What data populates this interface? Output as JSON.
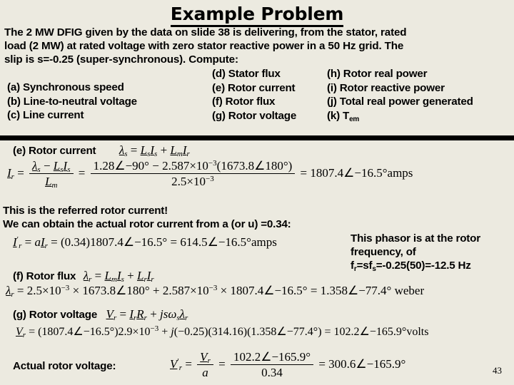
{
  "slide": {
    "title": "Example Problem",
    "page_number": "43",
    "background_color": "#ECEAE0",
    "divider_color": "#000000"
  },
  "problem": {
    "statement_lines": [
      "The 2 MW DFIG given by the data on slide 38 is delivering, from the stator, rated",
      "load (2 MW) at rated voltage with zero stator reactive power in a 50 Hz grid. The",
      "slip is s=-0.25 (super-synchronous). Compute:"
    ]
  },
  "compute_list": {
    "column_a": [
      "(a) Synchronous speed",
      "(b) Line-to-neutral voltage",
      "(c) Line current"
    ],
    "column_d": [
      "(d) Stator flux",
      "(e) Rotor current",
      "(f) Rotor flux",
      "(g) Rotor voltage"
    ],
    "column_h": [
      "(h) Rotor real power",
      "(i) Rotor reactive power",
      "(j) Total real power generated",
      "(k) Tem"
    ],
    "k_label_base": "(k) T",
    "k_label_sub": "em"
  },
  "section_e": {
    "label": "(e) Rotor current",
    "flux_equation": {
      "lhs": "λ",
      "lhs_sub": "s",
      "rhs": "L s I s + L m I r"
    },
    "result_equation": {
      "numerator_1": "1.28",
      "angle_1": "−90°",
      "term_2_coeff": "2.587×10",
      "term_2_exp": "−3",
      "term_2_mag": "1673.8",
      "term_2_angle": "180°",
      "denominator": "2.5×10",
      "denominator_exp": "−3",
      "result_mag": "1807.4",
      "result_angle": "−16.5°",
      "result_unit": "amps"
    }
  },
  "notes": {
    "line1": "This is the referred rotor current!",
    "line2": "We can obtain the actual rotor current from a (or u) =0.34:"
  },
  "actual_rotor_current": {
    "a_value": "0.34",
    "referred_mag": "1807.4",
    "referred_angle": "−16.5°",
    "result_mag": "614.5",
    "result_angle": "−16.5°",
    "result_unit": "amps"
  },
  "phasor_note": {
    "line1": "This phasor is at the rotor",
    "line2": "frequency, of",
    "line3_prefix": "f",
    "line3_sub1": "r",
    "line3_mid": "=sf",
    "line3_sub2": "s",
    "line3_rest": "=-0.25(50)=-12.5 Hz"
  },
  "section_f": {
    "label": "(f) Rotor flux",
    "definition_rhs": "L m I s + L r I r",
    "term1_coeff": "2.5×10",
    "term1_exp": "−3",
    "term1_mag": "1673.8",
    "term1_angle": "180°",
    "term2_coeff": "2.587×10",
    "term2_exp": "−3",
    "term2_mag": "1807.4",
    "term2_angle": "−16.5°",
    "result_mag": "1.358",
    "result_angle": "−77.4°",
    "result_unit": "weber"
  },
  "section_g": {
    "label": "(g) Rotor voltage",
    "definition_rhs": "I r R r + jsω s λ r",
    "current_mag": "1807.4",
    "current_angle": "−16.5°",
    "resistance": "2.9×10",
    "resistance_exp": "−3",
    "slip": "−0.25",
    "omega": "314.16",
    "flux_mag": "1.358",
    "flux_angle": "−77.4°",
    "result_mag": "102.2",
    "result_angle": "−165.9°",
    "result_unit": "volts"
  },
  "actual_rotor_voltage": {
    "label": "Actual rotor voltage:",
    "numerator_mag": "102.2",
    "numerator_angle": "−165.9°",
    "denominator": "0.34",
    "result_mag": "300.6",
    "result_angle": "−165.9°"
  }
}
